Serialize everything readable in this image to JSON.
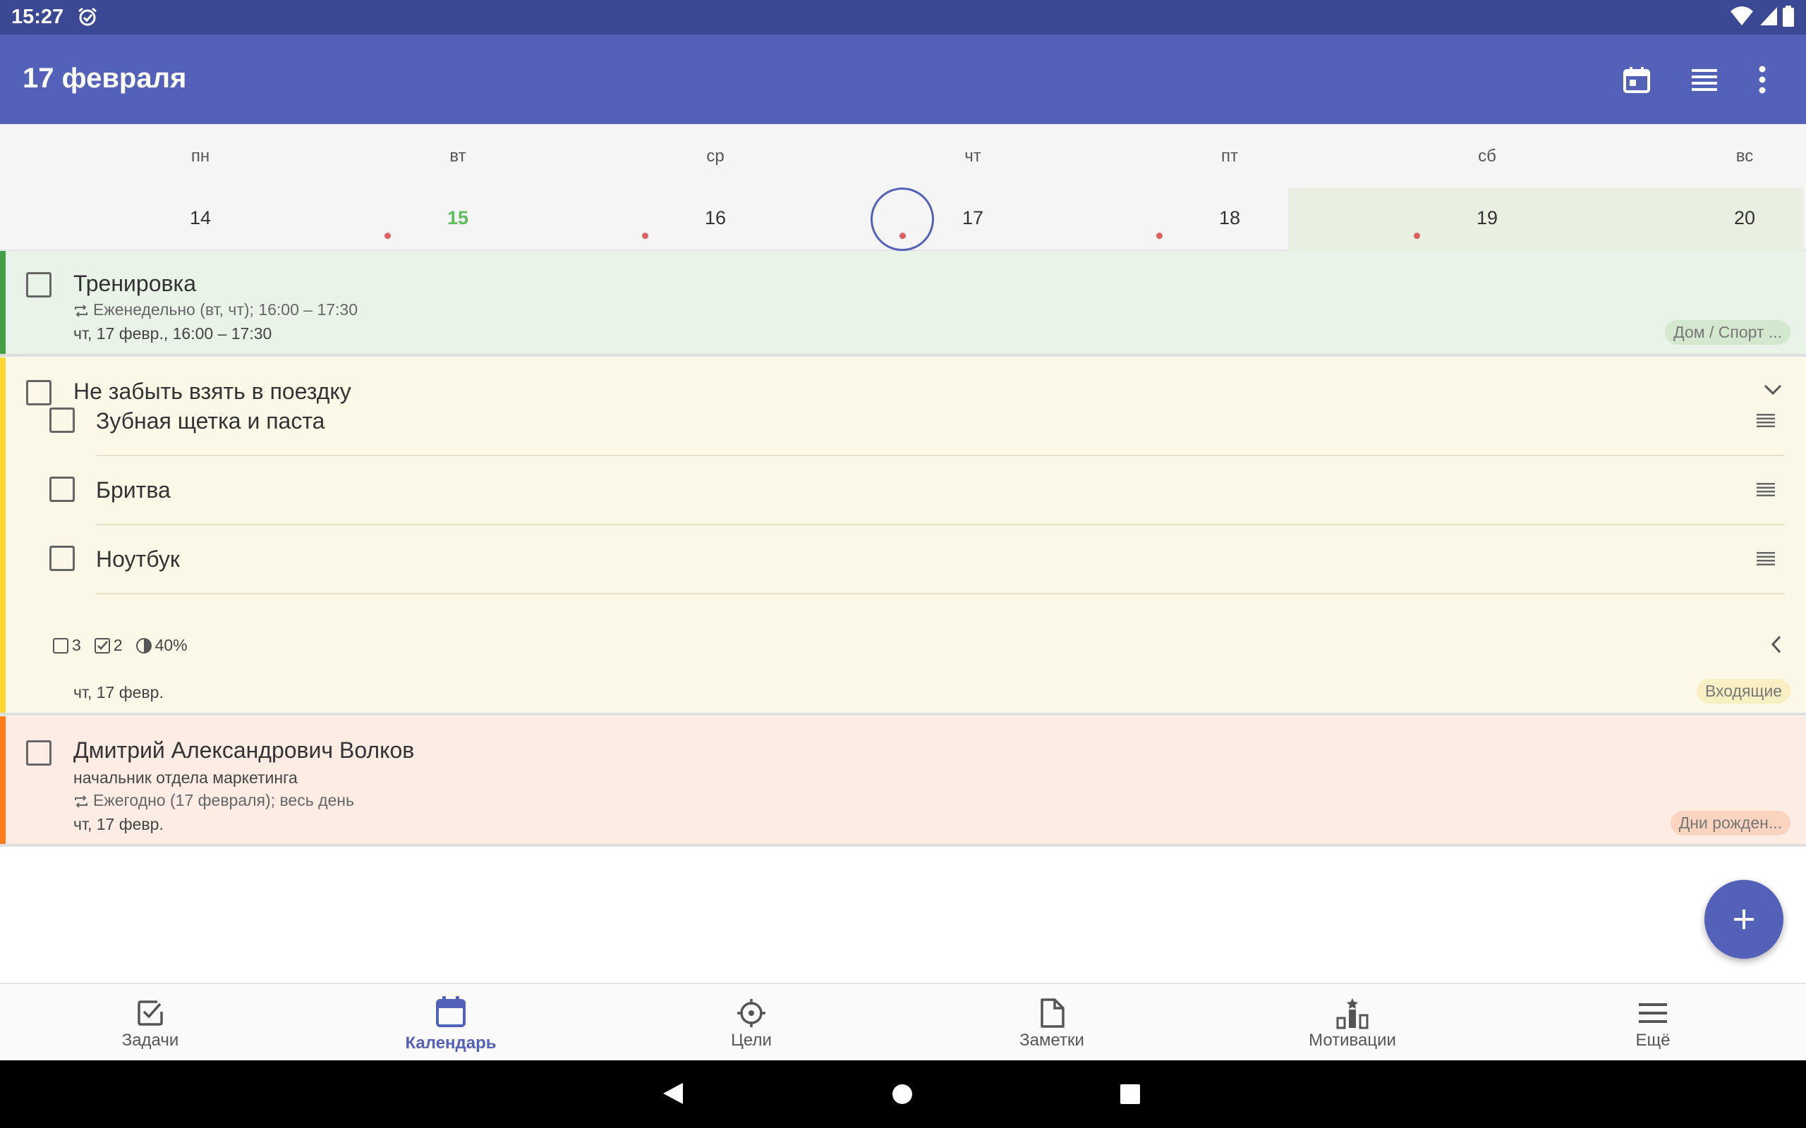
{
  "status_bar": {
    "time": "15:27"
  },
  "app_bar": {
    "title": "17 февраля"
  },
  "week": {
    "days": [
      {
        "name": "пн",
        "number": "14",
        "has_event": false,
        "highlighted": false
      },
      {
        "name": "вт",
        "number": "15",
        "has_event": true,
        "highlighted": true
      },
      {
        "name": "ср",
        "number": "16",
        "has_event": true,
        "highlighted": false
      },
      {
        "name": "чт",
        "number": "17",
        "has_event": true,
        "highlighted": false,
        "selected": true
      },
      {
        "name": "пт",
        "number": "18",
        "has_event": true,
        "highlighted": false
      },
      {
        "name": "сб",
        "number": "19",
        "has_event": true,
        "highlighted": false
      },
      {
        "name": "вс",
        "number": "20",
        "has_event": false,
        "highlighted": false
      }
    ]
  },
  "tasks": [
    {
      "title": "Тренировка",
      "repeat": "Еженедельно (вт, чт); 16:00 – 17:30",
      "date": "чт, 17 февр., 16:00 – 17:30",
      "tag": "Дом / Спорт ...",
      "color": "#43a047"
    },
    {
      "title": "Не забыть взять в поездку",
      "subtasks": [
        "Зубная щетка и паста",
        "Бритва",
        "Ноутбук"
      ],
      "stats": {
        "total": "3",
        "done": "2",
        "progress": "40%"
      },
      "date": "чт, 17 февр.",
      "tag": "Входящие",
      "color": "#fdd835"
    },
    {
      "title": "Дмитрий Александрович Волков",
      "description": "начальник отдела маркетинга",
      "repeat": "Ежегодно (17 февраля); весь день",
      "date": "чт, 17 февр.",
      "tag": "Дни рожден...",
      "color": "#ff7a1a"
    }
  ],
  "bottom_nav": [
    {
      "label": "Задачи",
      "icon": "tasks-icon",
      "active": false
    },
    {
      "label": "Календарь",
      "icon": "calendar-icon",
      "active": true
    },
    {
      "label": "Цели",
      "icon": "goals-icon",
      "active": false
    },
    {
      "label": "Заметки",
      "icon": "notes-icon",
      "active": false
    },
    {
      "label": "Мотивации",
      "icon": "motivation-icon",
      "active": false
    },
    {
      "label": "Ещё",
      "icon": "menu-icon",
      "active": false
    }
  ],
  "colors": {
    "primary": "#5461b8",
    "status_bar": "#3b4893",
    "accent_green": "#5cbf5c",
    "event_dot": "#e06060"
  }
}
